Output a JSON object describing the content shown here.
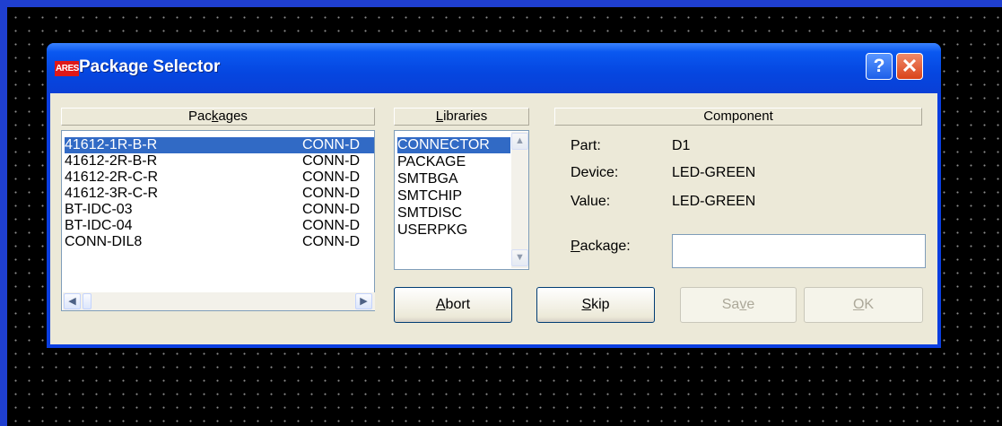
{
  "window": {
    "app_logo": "ARES",
    "title": "Package Selector",
    "help_symbol": "?",
    "close_symbol": "✕"
  },
  "packages": {
    "header_pre": "Pac",
    "header_u": "k",
    "header_post": "ages",
    "rows": [
      {
        "name": "41612-1R-B-R",
        "library": "CONN-D",
        "selected": true
      },
      {
        "name": "41612-2R-B-R",
        "library": "CONN-D"
      },
      {
        "name": "41612-2R-C-R",
        "library": "CONN-D"
      },
      {
        "name": "41612-3R-C-R",
        "library": "CONN-D"
      },
      {
        "name": "BT-IDC-03",
        "library": "CONN-D"
      },
      {
        "name": "BT-IDC-04",
        "library": "CONN-D"
      },
      {
        "name": "CONN-DIL8",
        "library": "CONN-D"
      }
    ]
  },
  "libraries": {
    "header_u": "L",
    "header_post": "ibraries",
    "items": [
      {
        "label": "CONNECTOR",
        "selected": true
      },
      {
        "label": "PACKAGE"
      },
      {
        "label": "SMTBGA"
      },
      {
        "label": "SMTCHIP"
      },
      {
        "label": "SMTDISC"
      },
      {
        "label": "USERPKG"
      }
    ]
  },
  "component": {
    "header": "Component",
    "part_label": "Part:",
    "part_value": "D1",
    "device_label": "Device:",
    "device_value": "LED-GREEN",
    "value_label": "Value:",
    "value_value": "LED-GREEN",
    "package_label_u": "P",
    "package_label_post": "ackage:",
    "package_value": ""
  },
  "buttons": {
    "abort_u": "A",
    "abort_post": "bort",
    "skip_u": "S",
    "skip_post": "kip",
    "save_pre": "Sa",
    "save_u": "v",
    "save_post": "e",
    "ok_u": "O",
    "ok_post": "K"
  }
}
